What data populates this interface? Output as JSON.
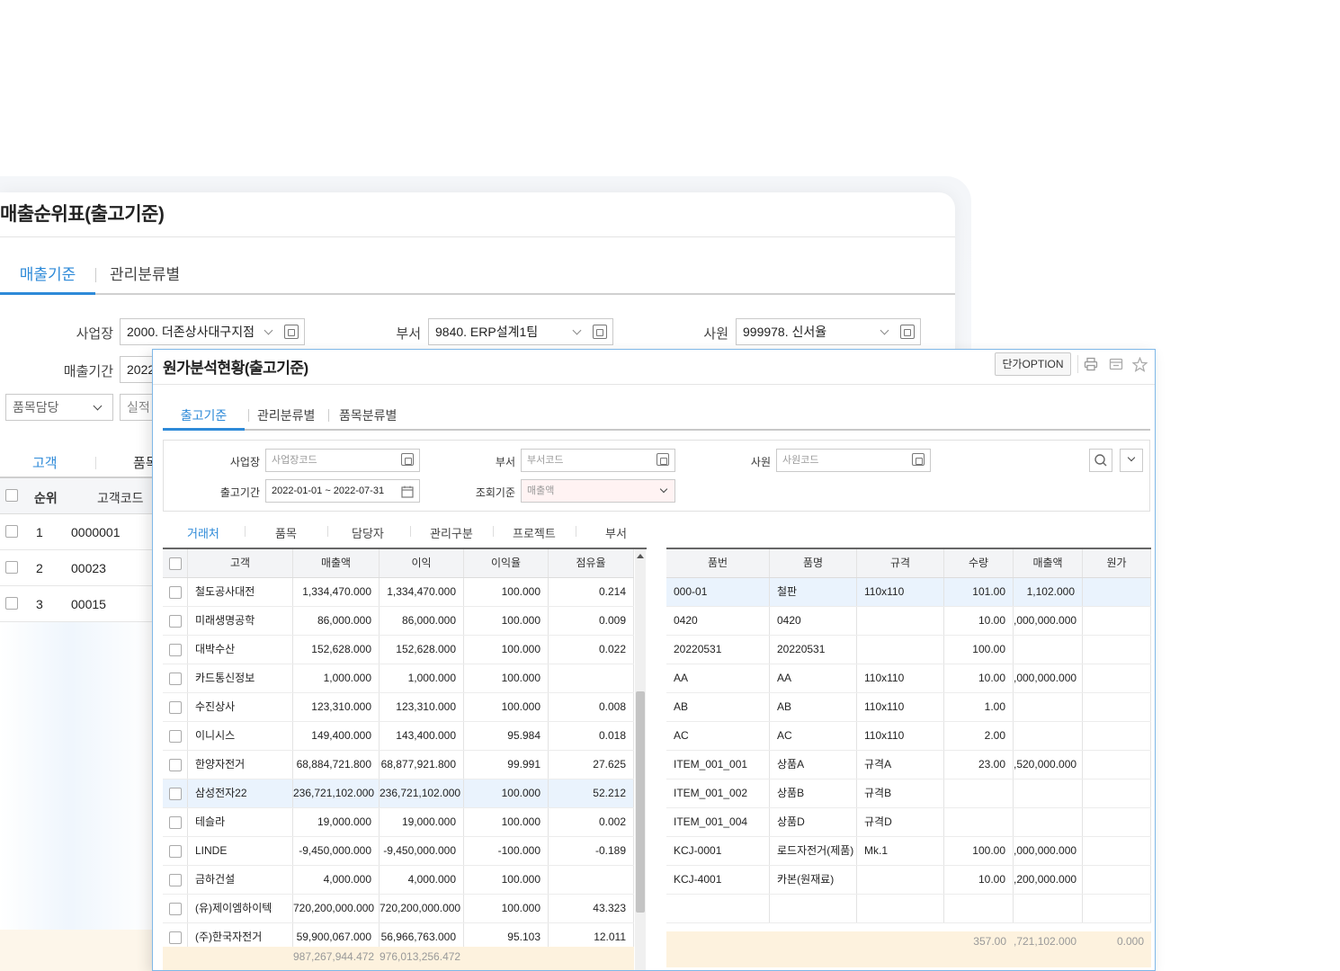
{
  "back_window": {
    "title": "매출순위표(출고기준)",
    "tabs": [
      {
        "label": "매출기준",
        "active": true
      },
      {
        "label": "관리분류별",
        "active": false
      }
    ],
    "fields": {
      "workplace_label": "사업장",
      "workplace_value": "2000. 더존상사대구지점",
      "dept_label": "부서",
      "dept_value": "9840. ERP설계1팀",
      "employee_label": "사원",
      "employee_value": "999978. 신서율",
      "period_label": "매출기간",
      "period_value": "2022",
      "item_manager_value": "품목담당",
      "perf_value": "실적"
    },
    "grid_tabs": [
      "고객",
      "품목"
    ],
    "columns": [
      "순위",
      "고객코드"
    ],
    "rows": [
      {
        "rank": "1",
        "code": "0000001"
      },
      {
        "rank": "2",
        "code": "00023"
      },
      {
        "rank": "3",
        "code": "00015"
      }
    ]
  },
  "front_window": {
    "title": "원가분석현황(출고기준)",
    "option_button": "단가OPTION",
    "icons": [
      "print-icon",
      "export-icon",
      "star-icon"
    ],
    "tabs": [
      {
        "label": "출고기준",
        "active": true
      },
      {
        "label": "관리분류별",
        "active": false
      },
      {
        "label": "품목분류별",
        "active": false
      }
    ],
    "search": {
      "workplace_label": "사업장",
      "workplace_placeholder": "사업장코드",
      "dept_label": "부서",
      "dept_placeholder": "부서코드",
      "employee_label": "사원",
      "employee_placeholder": "사원코드",
      "period_label": "출고기간",
      "period_value": "2022-01-01 ~ 2022-07-31",
      "criteria_label": "조회기준",
      "criteria_value": "매출액"
    },
    "sub_tabs": [
      {
        "label": "거래처",
        "active": true
      },
      {
        "label": "품목",
        "active": false
      },
      {
        "label": "담당자",
        "active": false
      },
      {
        "label": "관리구분",
        "active": false
      },
      {
        "label": "프로젝트",
        "active": false
      },
      {
        "label": "부서",
        "active": false
      }
    ],
    "left_grid": {
      "columns": [
        "고객",
        "매출액",
        "이익",
        "이익율",
        "점유율"
      ],
      "rows": [
        [
          "철도공사대전",
          "1,334,470.000",
          "1,334,470.000",
          "100.000",
          "0.214"
        ],
        [
          "미래생명공학",
          "86,000.000",
          "86,000.000",
          "100.000",
          "0.009"
        ],
        [
          "대박수산",
          "152,628.000",
          "152,628.000",
          "100.000",
          "0.022"
        ],
        [
          "카드통신정보",
          "1,000.000",
          "1,000.000",
          "100.000",
          ""
        ],
        [
          "수진상사",
          "123,310.000",
          "123,310.000",
          "100.000",
          "0.008"
        ],
        [
          "이니시스",
          "149,400.000",
          "143,400.000",
          "95.984",
          "0.018"
        ],
        [
          "한양자전거",
          "68,884,721.800",
          "68,877,921.800",
          "99.991",
          "27.625"
        ],
        [
          "삼성전자22",
          "236,721,102.000",
          "236,721,102.000",
          "100.000",
          "52.212"
        ],
        [
          "테슬라",
          "19,000.000",
          "19,000.000",
          "100.000",
          "0.002"
        ],
        [
          "LINDE",
          "-9,450,000.000",
          "-9,450,000.000",
          "-100.000",
          "-0.189"
        ],
        [
          "금하건설",
          "4,000.000",
          "4,000.000",
          "100.000",
          ""
        ],
        [
          "(유)제이엠하이텍",
          "720,200,000.000",
          "720,200,000.000",
          "100.000",
          "43.323"
        ],
        [
          "(주)한국자전거",
          "59,900,067.000",
          "56,966,763.000",
          "95.103",
          "12.011"
        ]
      ],
      "selected_row": 7,
      "footer": [
        "987,267,944.472",
        "976,013,256.472"
      ]
    },
    "right_grid": {
      "columns": [
        "품번",
        "품명",
        "규격",
        "수량",
        "매출액",
        "원가"
      ],
      "rows": [
        [
          "000-01",
          "철판",
          "110x110",
          "101.00",
          "1,102.000",
          ""
        ],
        [
          "0420",
          "0420",
          "",
          "10.00",
          ",000,000.000",
          ""
        ],
        [
          "20220531",
          "20220531",
          "",
          "100.00",
          "",
          ""
        ],
        [
          "AA",
          "AA",
          "110x110",
          "10.00",
          ",000,000.000",
          ""
        ],
        [
          "AB",
          "AB",
          "110x110",
          "1.00",
          "",
          ""
        ],
        [
          "AC",
          "AC",
          "110x110",
          "2.00",
          "",
          ""
        ],
        [
          "ITEM_001_001",
          "상품A",
          "규격A",
          "23.00",
          ",520,000.000",
          ""
        ],
        [
          "ITEM_001_002",
          "상품B",
          "규격B",
          "",
          "",
          ""
        ],
        [
          "ITEM_001_004",
          "상품D",
          "규격D",
          "",
          "",
          ""
        ],
        [
          "KCJ-0001",
          "로드자전거(제품)",
          "Mk.1",
          "100.00",
          ",000,000.000",
          ""
        ],
        [
          "KCJ-4001",
          "카본(원재료)",
          "",
          "10.00",
          ",200,000.000",
          ""
        ]
      ],
      "selected_row": 0,
      "footer": [
        "357.00",
        ",721,102.000",
        "0.000"
      ]
    }
  },
  "colors": {
    "accent": "#2e8ad8",
    "selected_row": "#eaf3fd",
    "footer": "#fdf2de",
    "frame": "#7fb8e8"
  }
}
